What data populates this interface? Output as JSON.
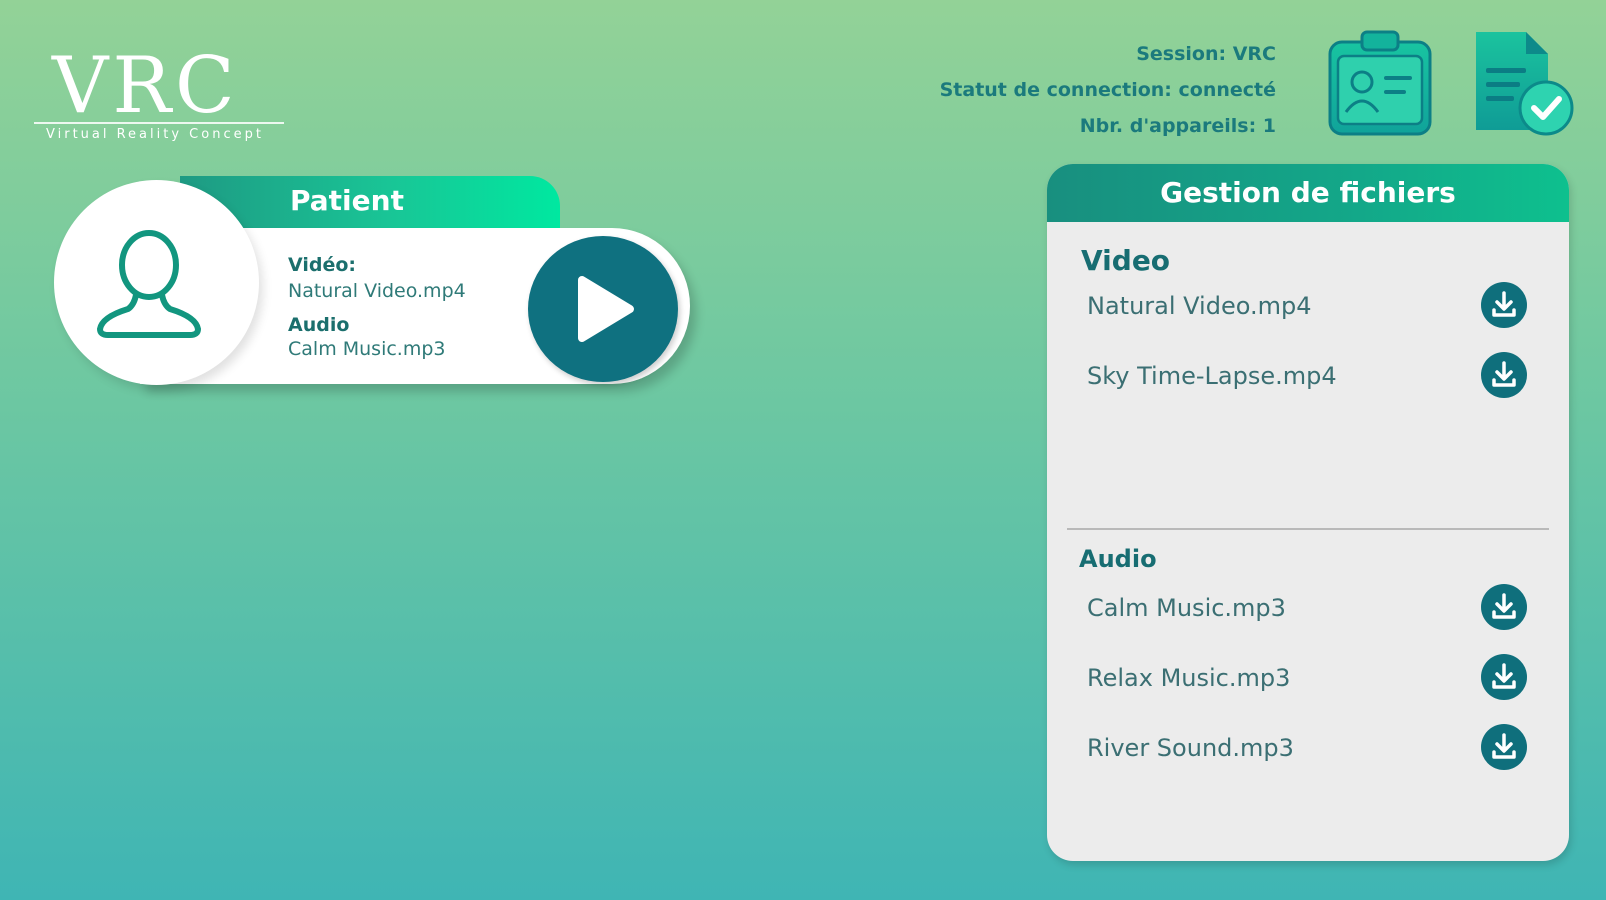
{
  "logo": {
    "name": "VRC",
    "tagline": "Virtual Reality Concept"
  },
  "session": {
    "session_line": "Session: VRC",
    "status_line": "Statut de connection: connecté",
    "devices_line": "Nbr. d'appareils: 1"
  },
  "icons": {
    "profile": "id-card-icon",
    "document": "document-check-icon"
  },
  "patient": {
    "title": "Patient",
    "video_label": "Vidéo:",
    "video_value": "Natural Video.mp4",
    "audio_label": "Audio",
    "audio_value": "Calm Music.mp3"
  },
  "files": {
    "title": "Gestion de fichiers",
    "video_section": "Video",
    "videos": [
      "Natural Video.mp4",
      "Sky Time-Lapse.mp4"
    ],
    "audio_section": "Audio",
    "audios": [
      "Calm Music.mp3",
      "Relax Music.mp3",
      "River Sound.mp3"
    ]
  },
  "colors": {
    "accent": "#0f7180",
    "header_green": "#19c596",
    "text_teal": "#1b7a7d"
  }
}
